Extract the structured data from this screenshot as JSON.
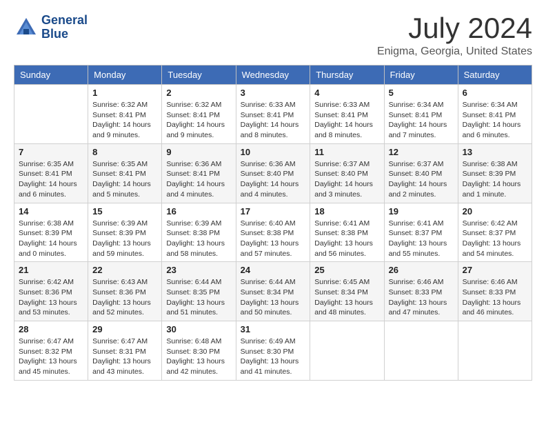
{
  "logo": {
    "text_line1": "General",
    "text_line2": "Blue"
  },
  "title": {
    "month_year": "July 2024",
    "location": "Enigma, Georgia, United States"
  },
  "days_of_week": [
    "Sunday",
    "Monday",
    "Tuesday",
    "Wednesday",
    "Thursday",
    "Friday",
    "Saturday"
  ],
  "weeks": [
    [
      {
        "day": "",
        "info": ""
      },
      {
        "day": "1",
        "info": "Sunrise: 6:32 AM\nSunset: 8:41 PM\nDaylight: 14 hours\nand 9 minutes."
      },
      {
        "day": "2",
        "info": "Sunrise: 6:32 AM\nSunset: 8:41 PM\nDaylight: 14 hours\nand 9 minutes."
      },
      {
        "day": "3",
        "info": "Sunrise: 6:33 AM\nSunset: 8:41 PM\nDaylight: 14 hours\nand 8 minutes."
      },
      {
        "day": "4",
        "info": "Sunrise: 6:33 AM\nSunset: 8:41 PM\nDaylight: 14 hours\nand 8 minutes."
      },
      {
        "day": "5",
        "info": "Sunrise: 6:34 AM\nSunset: 8:41 PM\nDaylight: 14 hours\nand 7 minutes."
      },
      {
        "day": "6",
        "info": "Sunrise: 6:34 AM\nSunset: 8:41 PM\nDaylight: 14 hours\nand 6 minutes."
      }
    ],
    [
      {
        "day": "7",
        "info": "Sunrise: 6:35 AM\nSunset: 8:41 PM\nDaylight: 14 hours\nand 6 minutes."
      },
      {
        "day": "8",
        "info": "Sunrise: 6:35 AM\nSunset: 8:41 PM\nDaylight: 14 hours\nand 5 minutes."
      },
      {
        "day": "9",
        "info": "Sunrise: 6:36 AM\nSunset: 8:41 PM\nDaylight: 14 hours\nand 4 minutes."
      },
      {
        "day": "10",
        "info": "Sunrise: 6:36 AM\nSunset: 8:40 PM\nDaylight: 14 hours\nand 4 minutes."
      },
      {
        "day": "11",
        "info": "Sunrise: 6:37 AM\nSunset: 8:40 PM\nDaylight: 14 hours\nand 3 minutes."
      },
      {
        "day": "12",
        "info": "Sunrise: 6:37 AM\nSunset: 8:40 PM\nDaylight: 14 hours\nand 2 minutes."
      },
      {
        "day": "13",
        "info": "Sunrise: 6:38 AM\nSunset: 8:39 PM\nDaylight: 14 hours\nand 1 minute."
      }
    ],
    [
      {
        "day": "14",
        "info": "Sunrise: 6:38 AM\nSunset: 8:39 PM\nDaylight: 14 hours\nand 0 minutes."
      },
      {
        "day": "15",
        "info": "Sunrise: 6:39 AM\nSunset: 8:39 PM\nDaylight: 13 hours\nand 59 minutes."
      },
      {
        "day": "16",
        "info": "Sunrise: 6:39 AM\nSunset: 8:38 PM\nDaylight: 13 hours\nand 58 minutes."
      },
      {
        "day": "17",
        "info": "Sunrise: 6:40 AM\nSunset: 8:38 PM\nDaylight: 13 hours\nand 57 minutes."
      },
      {
        "day": "18",
        "info": "Sunrise: 6:41 AM\nSunset: 8:38 PM\nDaylight: 13 hours\nand 56 minutes."
      },
      {
        "day": "19",
        "info": "Sunrise: 6:41 AM\nSunset: 8:37 PM\nDaylight: 13 hours\nand 55 minutes."
      },
      {
        "day": "20",
        "info": "Sunrise: 6:42 AM\nSunset: 8:37 PM\nDaylight: 13 hours\nand 54 minutes."
      }
    ],
    [
      {
        "day": "21",
        "info": "Sunrise: 6:42 AM\nSunset: 8:36 PM\nDaylight: 13 hours\nand 53 minutes."
      },
      {
        "day": "22",
        "info": "Sunrise: 6:43 AM\nSunset: 8:36 PM\nDaylight: 13 hours\nand 52 minutes."
      },
      {
        "day": "23",
        "info": "Sunrise: 6:44 AM\nSunset: 8:35 PM\nDaylight: 13 hours\nand 51 minutes."
      },
      {
        "day": "24",
        "info": "Sunrise: 6:44 AM\nSunset: 8:34 PM\nDaylight: 13 hours\nand 50 minutes."
      },
      {
        "day": "25",
        "info": "Sunrise: 6:45 AM\nSunset: 8:34 PM\nDaylight: 13 hours\nand 48 minutes."
      },
      {
        "day": "26",
        "info": "Sunrise: 6:46 AM\nSunset: 8:33 PM\nDaylight: 13 hours\nand 47 minutes."
      },
      {
        "day": "27",
        "info": "Sunrise: 6:46 AM\nSunset: 8:33 PM\nDaylight: 13 hours\nand 46 minutes."
      }
    ],
    [
      {
        "day": "28",
        "info": "Sunrise: 6:47 AM\nSunset: 8:32 PM\nDaylight: 13 hours\nand 45 minutes."
      },
      {
        "day": "29",
        "info": "Sunrise: 6:47 AM\nSunset: 8:31 PM\nDaylight: 13 hours\nand 43 minutes."
      },
      {
        "day": "30",
        "info": "Sunrise: 6:48 AM\nSunset: 8:30 PM\nDaylight: 13 hours\nand 42 minutes."
      },
      {
        "day": "31",
        "info": "Sunrise: 6:49 AM\nSunset: 8:30 PM\nDaylight: 13 hours\nand 41 minutes."
      },
      {
        "day": "",
        "info": ""
      },
      {
        "day": "",
        "info": ""
      },
      {
        "day": "",
        "info": ""
      }
    ]
  ]
}
